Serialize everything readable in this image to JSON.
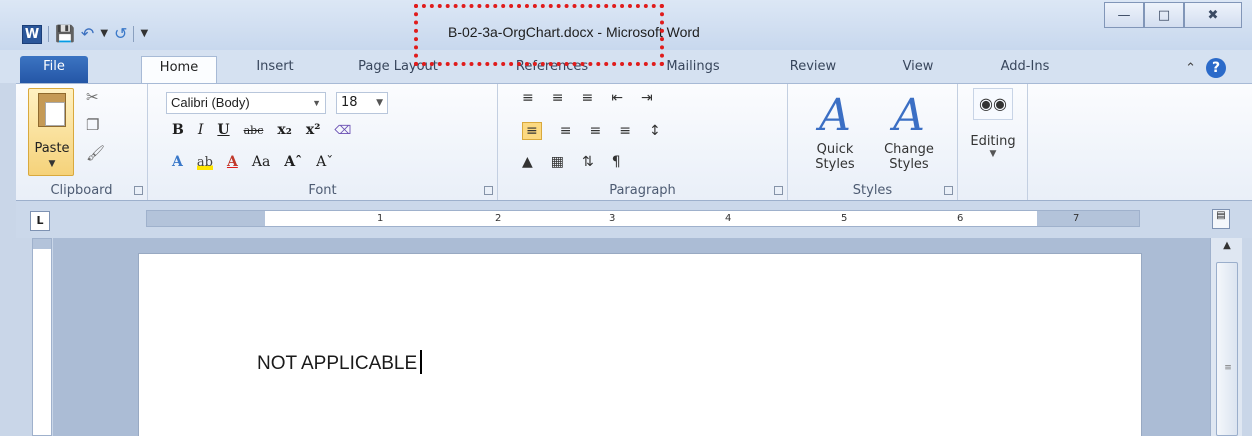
{
  "window": {
    "title": "B-02-3a-OrgChart.docx - Microsoft Word",
    "app_icon_letter": "W",
    "minimize": "—",
    "maximize": "□",
    "close": "✖"
  },
  "qat": {
    "save_icon": "save-icon",
    "undo_icon": "undo-icon",
    "redo_icon": "redo-icon",
    "customize_icon": "customize-icon"
  },
  "tabs": [
    "File",
    "Home",
    "Insert",
    "Page Layout",
    "References",
    "Mailings",
    "Review",
    "View",
    "Add-Ins"
  ],
  "ribbon": {
    "clipboard": {
      "label": "Clipboard",
      "paste_label": "Paste"
    },
    "font": {
      "label": "Font",
      "font_name": "Calibri (Body)",
      "font_size": "18",
      "bold": "B",
      "italic": "I",
      "underline": "U",
      "strikethrough": "abc",
      "subscript": "x₂",
      "superscript": "x²",
      "change_case": "Aa",
      "grow": "Aˆ",
      "shrink": "Aˇ"
    },
    "paragraph": {
      "label": "Paragraph",
      "pilcrow": "¶"
    },
    "styles": {
      "label": "Styles",
      "quick": "Quick",
      "quick2": "Styles",
      "change": "Change",
      "change2": "Styles"
    },
    "editing": {
      "label": "Editing"
    }
  },
  "ruler": {
    "tab_selector": "L",
    "numbers": [
      "1",
      "2",
      "3",
      "4",
      "5",
      "6",
      "7"
    ]
  },
  "document": {
    "text": "NOT APPLICABLE"
  },
  "colors": {
    "accent": "#2b579a",
    "highlight_box": "#e01c1c"
  }
}
